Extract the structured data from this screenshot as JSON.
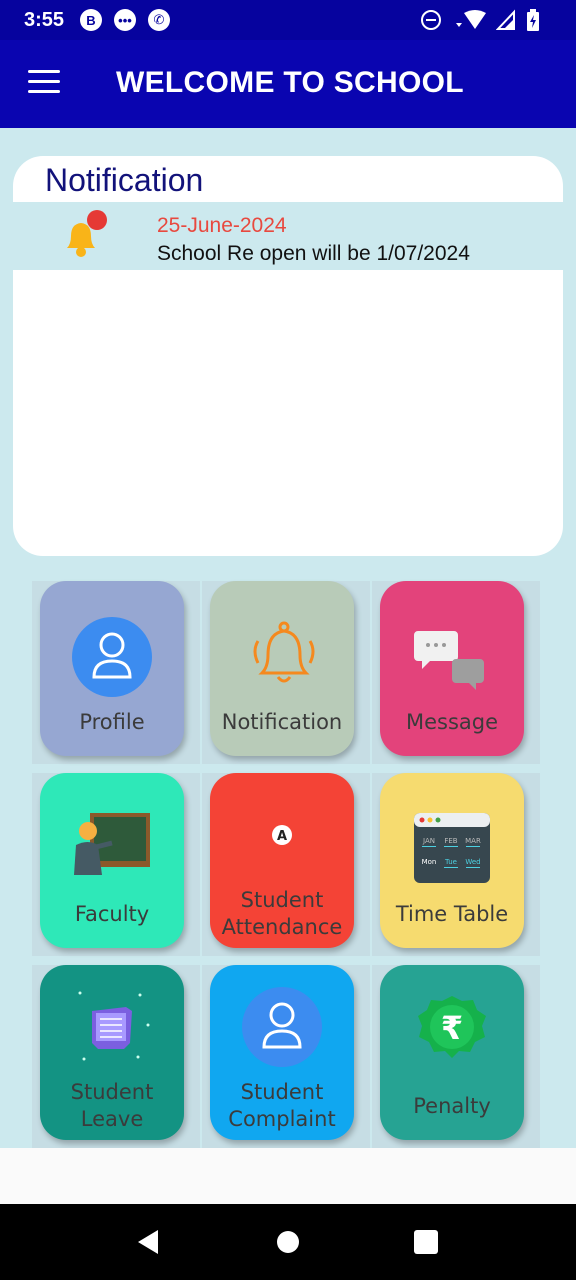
{
  "status_bar": {
    "time": "3:55",
    "icons": [
      "b-badge-icon",
      "chat-icon",
      "viber-icon",
      "dnd-icon",
      "wifi-icon",
      "signal-icon",
      "battery-icon"
    ]
  },
  "app_bar": {
    "title": "WELCOME TO SCHOOL"
  },
  "notification_card": {
    "heading": "Notification",
    "items": [
      {
        "date": "25-June-2024",
        "text": "School Re open will be 1/07/2024"
      }
    ]
  },
  "tiles": [
    {
      "label_lines": [
        "Profile"
      ],
      "bg": "#96a7d2"
    },
    {
      "label_lines": [
        "Notification"
      ],
      "bg": "#b8cbb8"
    },
    {
      "label_lines": [
        "Message"
      ],
      "bg": "#e3437b"
    },
    {
      "label_lines": [
        "Faculty"
      ],
      "bg": "#2ee8b8"
    },
    {
      "label_lines": [
        "Student",
        "Attendance"
      ],
      "bg": "#f44336"
    },
    {
      "label_lines": [
        "Time Table"
      ],
      "bg": "#f6db6f"
    },
    {
      "label_lines": [
        "Student",
        "Leave"
      ],
      "bg": "#139383"
    },
    {
      "label_lines": [
        "Student",
        "Complaint"
      ],
      "bg": "#10a7f0"
    },
    {
      "label_lines": [
        "Penalty"
      ],
      "bg": "#26a393"
    }
  ],
  "time_table_icon": {
    "months": [
      "JAN",
      "FEB",
      "MAR"
    ],
    "days": [
      "Mon",
      "Tue",
      "Wed"
    ]
  },
  "attendance_icon": {
    "letter": "A"
  },
  "colors": {
    "status_bar": "#06039e",
    "app_bar": "#0a05b0",
    "background": "#cce9ee",
    "date": "#e8493f"
  }
}
